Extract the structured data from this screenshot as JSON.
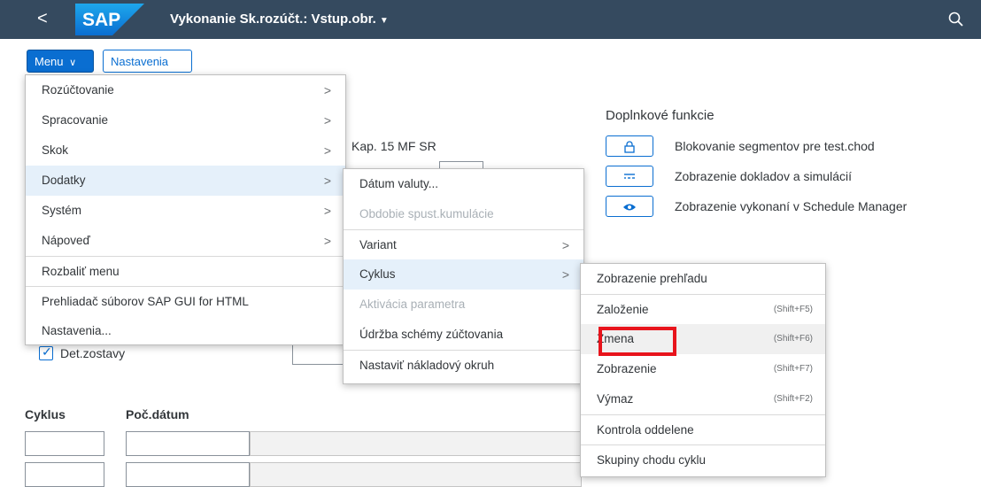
{
  "shell": {
    "back_glyph": "<",
    "logo_text": "SAP",
    "title": "Vykonanie Sk.rozúčt.: Vstup.obr.",
    "title_caret": "▼",
    "search_icon": "search-icon"
  },
  "toolbar": {
    "menu_label": "Menu",
    "menu_caret": "∨",
    "settings_label": "Nastavenia"
  },
  "background": {
    "extra_functions_heading": "Doplnkové funkcie",
    "kap_text": "Kap. 15 MF SR",
    "extra_buttons": [
      {
        "icon": "lock-icon",
        "label": "Blokovanie segmentov pre test.chod"
      },
      {
        "icon": "list-icon",
        "label": "Zobrazenie dokladov a simulácií"
      },
      {
        "icon": "eye-icon",
        "label": "Zobrazenie vykonaní v Schedule Manager"
      }
    ],
    "checkbox_label": "Det.zostavy",
    "checkbox_checked": true,
    "col_cyklus": "Cyklus",
    "col_pocdatum": "Poč.dátum"
  },
  "menu1": {
    "items": [
      {
        "label": "Rozúčtovanie",
        "arrow": ">"
      },
      {
        "label": "Spracovanie",
        "arrow": ">"
      },
      {
        "label": "Skok",
        "arrow": ">"
      },
      {
        "label": "Dodatky",
        "arrow": ">"
      },
      {
        "label": "Systém",
        "arrow": ">"
      },
      {
        "label": "Nápoveď",
        "arrow": ">"
      },
      {
        "label": "Rozbaliť menu"
      },
      {
        "label": "Prehliadač súborov SAP GUI for HTML"
      },
      {
        "label": "Nastavenia..."
      }
    ]
  },
  "menu2": {
    "items": [
      {
        "label": "Dátum valuty..."
      },
      {
        "label": "Obdobie spust.kumulácie"
      },
      {
        "label": "Variant",
        "arrow": ">"
      },
      {
        "label": "Cyklus",
        "arrow": ">"
      },
      {
        "label": "Aktivácia parametra"
      },
      {
        "label": "Údržba schémy zúčtovania"
      },
      {
        "label": "Nastaviť nákladový okruh"
      }
    ]
  },
  "menu3": {
    "items": [
      {
        "label": "Zobrazenie prehľadu",
        "shortcut": ""
      },
      {
        "label": "Založenie",
        "shortcut": "(Shift+F5)"
      },
      {
        "label": "Zmena",
        "shortcut": "(Shift+F6)"
      },
      {
        "label": "Zobrazenie",
        "shortcut": "(Shift+F7)"
      },
      {
        "label": "Výmaz",
        "shortcut": "(Shift+F2)"
      },
      {
        "label": "Kontrola oddelene",
        "shortcut": ""
      },
      {
        "label": "Skupiny chodu cyklu",
        "shortcut": ""
      }
    ]
  },
  "colors": {
    "shell": "#354a5f",
    "accent": "#0a6ed1",
    "highlight_box": "#e8141c"
  }
}
